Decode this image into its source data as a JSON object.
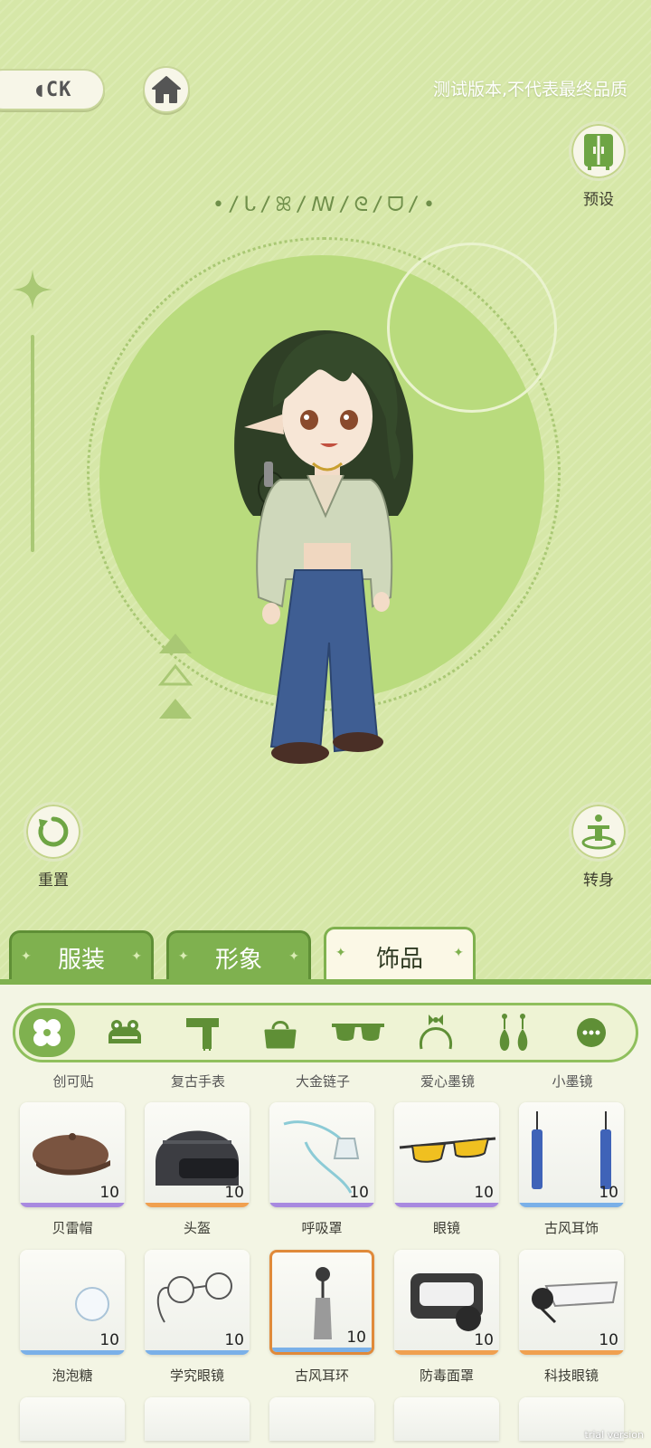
{
  "header": {
    "back_label": "◖CK",
    "home_icon": "home-icon",
    "test_note": "测试版本,不代表最终品质"
  },
  "side": {
    "preset_label": "预设",
    "reset_label": "重置",
    "turn_label": "转身"
  },
  "rune_text": "•/ᒐ/ꕤ/ꟿ/ᘓ/ᗜ/•",
  "tabs": [
    {
      "label": "服装",
      "active": false
    },
    {
      "label": "形象",
      "active": false
    },
    {
      "label": "饰品",
      "active": true
    }
  ],
  "categories": [
    "flower-icon",
    "frog-hat-icon",
    "scarf-icon",
    "bag-icon",
    "sunglasses-icon",
    "headband-icon",
    "earrings-icon",
    "more-icon"
  ],
  "previous_row_names": [
    "创可贴",
    "复古手表",
    "大金链子",
    "爱心墨镜",
    "小墨镜"
  ],
  "items": [
    [
      {
        "name": "贝雷帽",
        "count": "10",
        "rarity": "#a889e0",
        "art": "beret"
      },
      {
        "name": "头盔",
        "count": "10",
        "rarity": "#f0a050",
        "art": "helmet"
      },
      {
        "name": "呼吸罩",
        "count": "10",
        "rarity": "#a889e0",
        "art": "mask"
      },
      {
        "name": "眼镜",
        "count": "10",
        "rarity": "#a889e0",
        "art": "glasses"
      },
      {
        "name": "古风耳饰",
        "count": "10",
        "rarity": "#7ab0e8",
        "art": "earrings"
      }
    ],
    [
      {
        "name": "泡泡糖",
        "count": "10",
        "rarity": "#7ab0e8",
        "art": "bubble"
      },
      {
        "name": "学究眼镜",
        "count": "10",
        "rarity": "#7ab0e8",
        "art": "roundglasses"
      },
      {
        "name": "古风耳环",
        "count": "10",
        "rarity": "#7ab0e8",
        "art": "earring",
        "selected": true
      },
      {
        "name": "防毒面罩",
        "count": "10",
        "rarity": "#f0a050",
        "art": "gasmask"
      },
      {
        "name": "科技眼镜",
        "count": "10",
        "rarity": "#f0a050",
        "art": "visor"
      }
    ]
  ],
  "watermark": "trial version"
}
